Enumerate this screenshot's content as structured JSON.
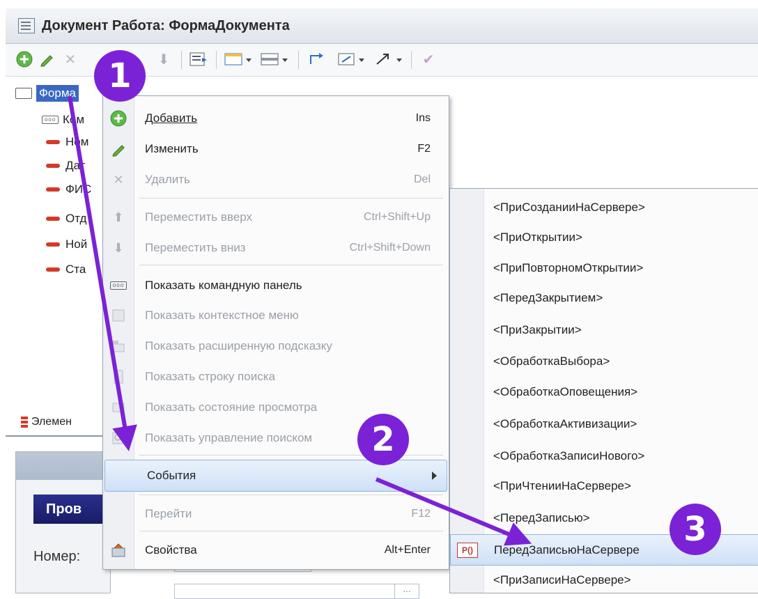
{
  "window": {
    "title": "Документ Работа: ФормаДокумента"
  },
  "tree": {
    "root": "Форма",
    "items": [
      "Ком",
      "Ном",
      "Дат",
      "ФИС",
      "Отд",
      "Ной",
      "Ста"
    ],
    "elements_tab": "Элемен"
  },
  "preview": {
    "button": "Пров",
    "number_label": "Номер:"
  },
  "context_menu": {
    "items": [
      {
        "label": "Добавить",
        "shortcut": "Ins",
        "icon": "add-icon",
        "disabled": false
      },
      {
        "label": "Изменить",
        "shortcut": "F2",
        "icon": "pencil-icon",
        "disabled": false
      },
      {
        "label": "Удалить",
        "shortcut": "Del",
        "icon": "delete-icon",
        "disabled": true
      },
      {
        "label": "Переместить вверх",
        "shortcut": "Ctrl+Shift+Up",
        "icon": "arrow-up-icon",
        "disabled": true
      },
      {
        "label": "Переместить вниз",
        "shortcut": "Ctrl+Shift+Down",
        "icon": "arrow-down-icon",
        "disabled": true
      },
      {
        "label": "Показать командную панель",
        "shortcut": "",
        "icon": "command-panel-icon",
        "disabled": false
      },
      {
        "label": "Показать контекстное меню",
        "shortcut": "",
        "icon": "context-menu-icon",
        "disabled": true
      },
      {
        "label": "Показать расширенную подсказку",
        "shortcut": "",
        "icon": "tooltip-icon",
        "disabled": true
      },
      {
        "label": "Показать строку поиска",
        "shortcut": "",
        "icon": "search-bar-icon",
        "disabled": true
      },
      {
        "label": "Показать состояние просмотра",
        "shortcut": "",
        "icon": "view-state-icon",
        "disabled": true
      },
      {
        "label": "Показать управление поиском",
        "shortcut": "",
        "icon": "search-control-icon",
        "disabled": true
      },
      {
        "label": "События",
        "shortcut": "",
        "icon": "",
        "disabled": false
      },
      {
        "label": "Перейти",
        "shortcut": "F12",
        "icon": "",
        "disabled": true
      },
      {
        "label": "Свойства",
        "shortcut": "Alt+Enter",
        "icon": "properties-icon",
        "disabled": false
      }
    ]
  },
  "events_submenu": {
    "items": [
      "<ПриСозданииНаСервере>",
      "<ПриОткрытии>",
      "<ПриПовторномОткрытии>",
      "<ПередЗакрытием>",
      "<ПриЗакрытии>",
      "<ОбработкаВыбора>",
      "<ОбработкаОповещения>",
      "<ОбработкаАктивизации>",
      "<ОбработкаЗаписиНового>",
      "<ПриЧтенииНаСервере>",
      "<ПередЗаписью>",
      "ПередЗаписьюНаСервере",
      "<ПриЗаписиНаСервере>"
    ],
    "selected_badge": "Р()"
  },
  "annotations": {
    "step1": "1",
    "step2": "2",
    "step3": "3",
    "color": "#7b22d6"
  },
  "colors": {
    "selection": "#3a67c2",
    "menu_highlight": "#cfe0f7",
    "field_red": "#d23a2c"
  }
}
